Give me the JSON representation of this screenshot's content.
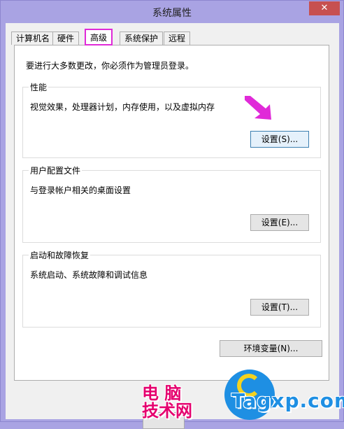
{
  "window": {
    "title": "系统属性",
    "close_label": "✕"
  },
  "tabs": [
    {
      "label": "计算机名"
    },
    {
      "label": "硬件"
    },
    {
      "label": "高级"
    },
    {
      "label": "系统保护"
    },
    {
      "label": "远程"
    }
  ],
  "active_tab": "高级",
  "notice": "要进行大多数更改，你必须作为管理员登录。",
  "groups": {
    "performance": {
      "title": "性能",
      "description": "视觉效果，处理器计划，内存使用，以及虚拟内存",
      "button_label": "设置(S)..."
    },
    "profiles": {
      "title": "用户配置文件",
      "description": "与登录帐户相关的桌面设置",
      "button_label": "设置(E)..."
    },
    "startup": {
      "title": "启动和故障恢复",
      "description": "系统启动、系统故障和调试信息",
      "button_label": "设置(T)..."
    }
  },
  "env_button_label": "环境变量(N)...",
  "watermark": {
    "cn_line1": "电 脑",
    "cn_line2": "技术网",
    "en": "Tagxp.com"
  },
  "colors": {
    "highlight": "#e02ad8",
    "arrow": "#e02ad8",
    "watermark_cn": "#e5006e",
    "watermark_en": "#1e8fe3"
  }
}
